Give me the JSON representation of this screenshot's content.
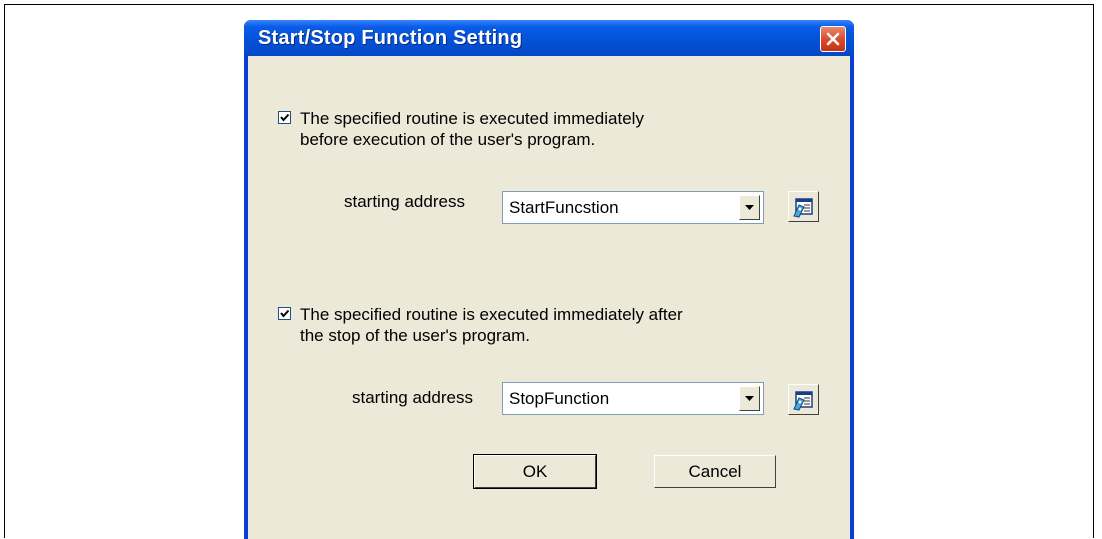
{
  "dialog": {
    "title": "Start/Stop Function Setting",
    "close_icon": "close-x-icon"
  },
  "start_section": {
    "checked": true,
    "label": "The specified routine is executed immediately\nbefore execution of the user's program.",
    "address_label": "starting address",
    "address_value": "StartFuncstion",
    "dropdown_icon": "chevron-down-icon",
    "browse_icon": "symbol-browse-icon"
  },
  "stop_section": {
    "checked": true,
    "label": "The specified routine is executed immediately after\nthe stop of the user's  program.",
    "address_label": "starting address",
    "address_value": "StopFunction",
    "dropdown_icon": "chevron-down-icon",
    "browse_icon": "symbol-browse-icon"
  },
  "buttons": {
    "ok": "OK",
    "cancel": "Cancel"
  },
  "colors": {
    "titlebar": "#0352d8",
    "client": "#ece9d8",
    "close_button": "#d9482a"
  }
}
